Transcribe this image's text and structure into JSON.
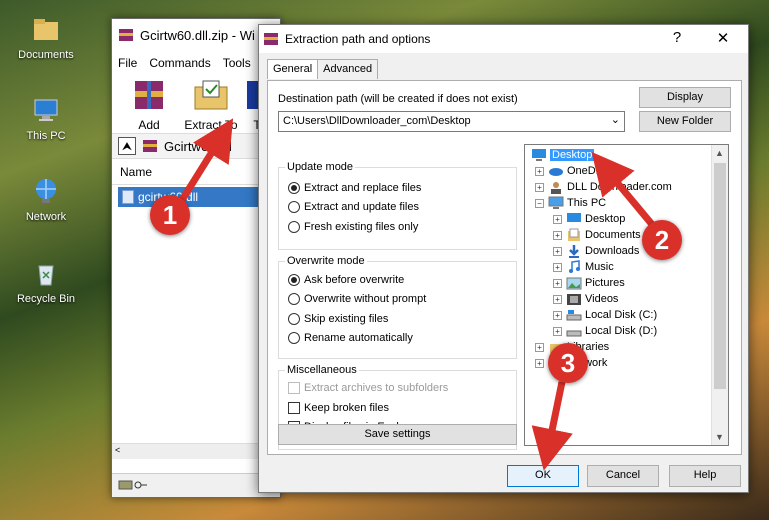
{
  "desktop": {
    "icons": [
      {
        "label": "Documents",
        "icon": "folder-icon"
      },
      {
        "label": "This PC",
        "icon": "computer-icon"
      },
      {
        "label": "Network",
        "icon": "network-icon"
      },
      {
        "label": "Recycle Bin",
        "icon": "recycle-bin-icon"
      }
    ]
  },
  "winrar": {
    "title": "Gcirtw60.dll.zip - Wi",
    "menu": [
      "File",
      "Commands",
      "Tools"
    ],
    "tools": [
      {
        "label": "Add"
      },
      {
        "label": "Extract To"
      },
      {
        "label": "T"
      }
    ],
    "path": "Gcirtw60.dll",
    "column_name": "Name",
    "file": "gcirtw60.dll"
  },
  "dialog": {
    "title": "Extraction path and options",
    "help": "?",
    "close": "✕",
    "tabs": [
      "General",
      "Advanced"
    ],
    "dest_label": "Destination path (will be created if does not exist)",
    "dest_value": "C:\\Users\\DllDownloader_com\\Desktop",
    "display_btn": "Display",
    "new_folder_btn": "New Folder",
    "update_mode": {
      "title": "Update mode",
      "options": [
        "Extract and replace files",
        "Extract and update files",
        "Fresh existing files only"
      ],
      "selected": 0
    },
    "overwrite_mode": {
      "title": "Overwrite mode",
      "options": [
        "Ask before overwrite",
        "Overwrite without prompt",
        "Skip existing files",
        "Rename automatically"
      ],
      "selected": 0
    },
    "misc": {
      "title": "Miscellaneous",
      "options": [
        "Extract archives to subfolders",
        "Keep broken files",
        "Display files in Explorer"
      ]
    },
    "save_settings": "Save settings",
    "ok": "OK",
    "cancel": "Cancel",
    "help_btn": "Help",
    "tree": [
      {
        "label": "Desktop",
        "selected": true
      },
      {
        "label": "OneDrive"
      },
      {
        "label": "DLL Downloader.com"
      },
      {
        "label": "This PC"
      },
      {
        "label": "Desktop"
      },
      {
        "label": "Documents"
      },
      {
        "label": "Downloads"
      },
      {
        "label": "Music"
      },
      {
        "label": "Pictures"
      },
      {
        "label": "Videos"
      },
      {
        "label": "Local Disk (C:)"
      },
      {
        "label": "Local Disk (D:)"
      },
      {
        "label": "Libraries"
      },
      {
        "label": "Network"
      }
    ]
  },
  "annotations": {
    "step1": "1",
    "step2": "2",
    "step3": "3",
    "color": "#d9302a"
  }
}
